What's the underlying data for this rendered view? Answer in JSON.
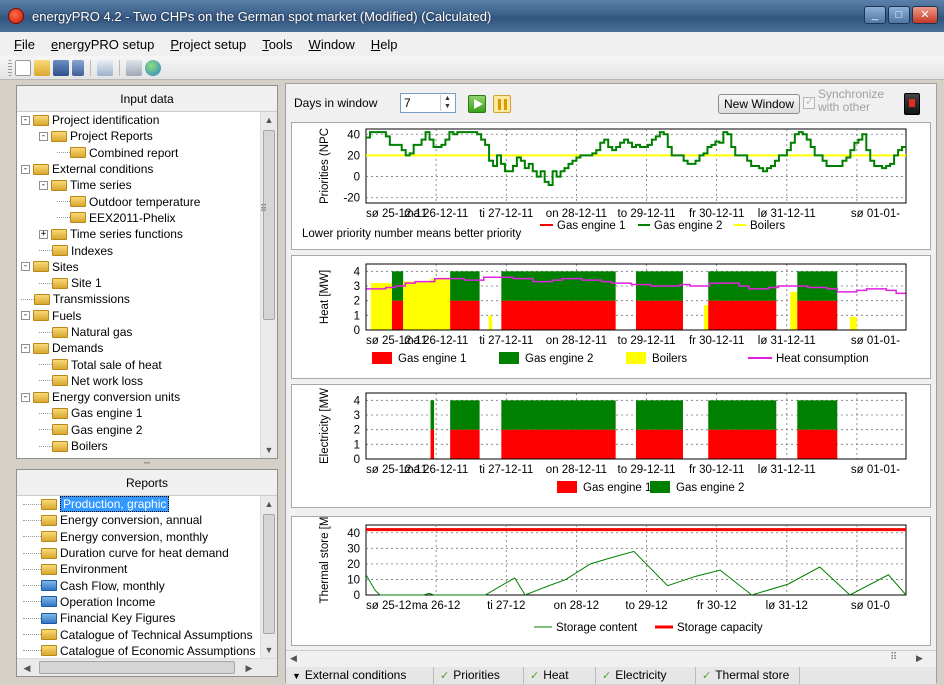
{
  "window": {
    "title": "energyPRO 4.2  -  Two CHPs on the German spot market (Modified) (Calculated)"
  },
  "menu": [
    "File",
    "energyPRO setup",
    "Project setup",
    "Tools",
    "Window",
    "Help"
  ],
  "input_panel": {
    "title": "Input data",
    "items": [
      {
        "label": "Project identification",
        "level": 0,
        "exp": "-"
      },
      {
        "label": "Project Reports",
        "level": 1,
        "exp": "-"
      },
      {
        "label": "Combined report",
        "level": 2,
        "exp": ""
      },
      {
        "label": "External conditions",
        "level": 0,
        "exp": "-"
      },
      {
        "label": "Time series",
        "level": 1,
        "exp": "-"
      },
      {
        "label": "Outdoor temperature",
        "level": 2,
        "exp": ""
      },
      {
        "label": "EEX2011-Phelix",
        "level": 2,
        "exp": ""
      },
      {
        "label": "Time series functions",
        "level": 1,
        "exp": "+"
      },
      {
        "label": "Indexes",
        "level": 1,
        "exp": ""
      },
      {
        "label": "Sites",
        "level": 0,
        "exp": "-"
      },
      {
        "label": "Site 1",
        "level": 1,
        "exp": ""
      },
      {
        "label": "Transmissions",
        "level": 0,
        "exp": ""
      },
      {
        "label": "Fuels",
        "level": 0,
        "exp": "-"
      },
      {
        "label": "Natural gas",
        "level": 1,
        "exp": ""
      },
      {
        "label": "Demands",
        "level": 0,
        "exp": "-"
      },
      {
        "label": "Total sale of heat",
        "level": 1,
        "exp": ""
      },
      {
        "label": "Net work loss",
        "level": 1,
        "exp": ""
      },
      {
        "label": "Energy conversion units",
        "level": 0,
        "exp": "-"
      },
      {
        "label": "Gas engine 1",
        "level": 1,
        "exp": ""
      },
      {
        "label": "Gas engine 2",
        "level": 1,
        "exp": ""
      },
      {
        "label": "Boilers",
        "level": 1,
        "exp": ""
      }
    ]
  },
  "reports_panel": {
    "title": "Reports",
    "items": [
      {
        "label": "Production, graphic",
        "color": "yellow",
        "selected": true
      },
      {
        "label": "Energy conversion, annual",
        "color": "yellow"
      },
      {
        "label": "Energy conversion, monthly",
        "color": "yellow"
      },
      {
        "label": "Duration curve for heat demand",
        "color": "yellow"
      },
      {
        "label": "Environment",
        "color": "yellow"
      },
      {
        "label": "Cash Flow, monthly",
        "color": "blue"
      },
      {
        "label": "Operation Income",
        "color": "blue"
      },
      {
        "label": "Financial Key Figures",
        "color": "blue"
      },
      {
        "label": "Catalogue of Technical Assumptions",
        "color": "yellow"
      },
      {
        "label": "Catalogue of Economic Assumptions",
        "color": "yellow"
      }
    ]
  },
  "controls": {
    "days_label": "Days in window",
    "days_value": "7",
    "new_window": "New Window",
    "sync_label": "Synchronize with other"
  },
  "colors": {
    "engine1": "#ff0000",
    "engine2": "#008000",
    "boilers": "#ffff00",
    "heat_consumption": "#e020e0",
    "storage_content": "#008000",
    "storage_capacity": "#ff0000"
  },
  "chart_data": [
    {
      "type": "line",
      "ylabel": "Priorities (NPC",
      "ylim": [
        -25,
        45
      ],
      "yticks": [
        40,
        20,
        0,
        -20
      ],
      "xticks": [
        "sø 25-12-11",
        "ma 26-12-11",
        "ti 27-12-11",
        "on 28-12-11",
        "to 29-12-11",
        "fr 30-12-11",
        "lø 31-12-11",
        "sø 01-01-"
      ],
      "note": "Lower priority number means better priority",
      "legend": [
        "Gas engine 1",
        "Gas engine 2",
        "Boilers"
      ],
      "series": [
        {
          "name": "Gas engine 2",
          "values": [
            37,
            42,
            42,
            42,
            42,
            38,
            30,
            30,
            30,
            25,
            20,
            22,
            30,
            30,
            35,
            42,
            35,
            28,
            28,
            30,
            35,
            42,
            40,
            42,
            42,
            42,
            42,
            42,
            40,
            35,
            30,
            15,
            10,
            20,
            12,
            5,
            5,
            10,
            18,
            15,
            8,
            12,
            5,
            0,
            5,
            -5,
            -8,
            5,
            0,
            5,
            8,
            12,
            15,
            18,
            20,
            20,
            20,
            22,
            25,
            32,
            35,
            28,
            25,
            28,
            32,
            35,
            32,
            28,
            30,
            28,
            28,
            30,
            35,
            38,
            42,
            40,
            28,
            20,
            20,
            20,
            15,
            12,
            12,
            15,
            20,
            22,
            28,
            30,
            33,
            32,
            42,
            40,
            28,
            20,
            20,
            20,
            15,
            10,
            10,
            8,
            5,
            8,
            10,
            15,
            20,
            20,
            25,
            32,
            40,
            42,
            40,
            35,
            28,
            20,
            20,
            15,
            10,
            10,
            10,
            10,
            15,
            18,
            25,
            32,
            35,
            40,
            25,
            15,
            10,
            10,
            8,
            10,
            12,
            20,
            25,
            28
          ]
        },
        {
          "name": "Boilers",
          "values": [
            20,
            20
          ]
        }
      ]
    },
    {
      "type": "bar",
      "ylabel": "Heat [MW]",
      "ylim": [
        0,
        4.5
      ],
      "yticks": [
        4,
        3,
        2,
        1,
        0
      ],
      "xticks": [
        "sø 25-12-11",
        "ma 26-12-11",
        "ti 27-12-11",
        "on 28-12-11",
        "to 29-12-11",
        "fr 30-12-11",
        "lø 31-12-11",
        "sø 01-01-"
      ],
      "legend": [
        "Gas engine 1",
        "Gas engine 2",
        "Boilers",
        "Heat consumption"
      ],
      "blocks": [
        {
          "x0": 0.07,
          "x1": 0.37,
          "engine1": 0,
          "engine2": 0,
          "boilers": 3.2
        },
        {
          "x0": 0.37,
          "x1": 0.53,
          "engine1": 2.0,
          "engine2": 2.0,
          "boilers": 0
        },
        {
          "x0": 0.53,
          "x1": 0.92,
          "engine1": 0,
          "engine2": 0,
          "boilers": 3.3
        },
        {
          "x0": 0.92,
          "x1": 1.2,
          "engine1": 0,
          "engine2": 0,
          "boilers": 3.5
        },
        {
          "x0": 1.2,
          "x1": 1.62,
          "engine1": 2.0,
          "engine2": 2.0,
          "boilers": 0
        },
        {
          "x0": 1.75,
          "x1": 1.8,
          "engine1": 0,
          "engine2": 0,
          "boilers": 1.0
        },
        {
          "x0": 1.8,
          "x1": 1.93,
          "engine1": 0,
          "engine2": 0,
          "boilers": 0
        },
        {
          "x0": 1.93,
          "x1": 3.56,
          "engine1": 2.0,
          "engine2": 2.0,
          "boilers": 0
        },
        {
          "x0": 3.85,
          "x1": 4.52,
          "engine1": 2.0,
          "engine2": 2.0,
          "boilers": 0
        },
        {
          "x0": 4.82,
          "x1": 4.88,
          "engine1": 0,
          "engine2": 0,
          "boilers": 1.7
        },
        {
          "x0": 4.88,
          "x1": 5.85,
          "engine1": 2.0,
          "engine2": 2.0,
          "boilers": 0
        },
        {
          "x0": 6.05,
          "x1": 6.15,
          "engine1": 0,
          "engine2": 0,
          "boilers": 2.6
        },
        {
          "x0": 6.15,
          "x1": 6.72,
          "engine1": 2.0,
          "engine2": 2.0,
          "boilers": 0
        },
        {
          "x0": 6.9,
          "x1": 7.0,
          "engine1": 0,
          "engine2": 0,
          "boilers": 0.9
        }
      ],
      "heat_consumption": [
        2.8,
        2.8,
        2.9,
        3.0,
        3.2,
        3.3,
        3.3,
        3.5,
        3.5,
        3.5,
        3.4,
        3.4,
        3.6,
        3.6,
        3.6,
        3.5,
        3.5,
        3.3,
        3.3,
        3.4,
        3.5,
        3.5,
        3.4,
        3.4,
        3.3,
        3.2,
        3.2,
        3.1,
        3.1,
        3.0,
        3.0,
        3.0,
        3.1,
        3.0,
        3.0,
        3.2,
        3.2,
        3.2,
        3.0,
        2.8,
        2.8,
        2.9,
        3.0,
        3.0,
        3.0,
        2.9,
        2.9,
        2.8,
        2.6,
        2.6,
        2.7,
        2.8,
        2.8,
        2.7,
        2.5
      ]
    },
    {
      "type": "bar",
      "ylabel": "Electricity [MW",
      "ylim": [
        0,
        4.5
      ],
      "yticks": [
        4,
        3,
        2,
        1,
        0
      ],
      "xticks": [
        "sø 25-12-11",
        "ma 26-12-11",
        "ti 27-12-11",
        "on 28-12-11",
        "to 29-12-11",
        "fr 30-12-11",
        "lø 31-12-11",
        "sø 01-01-"
      ],
      "legend": [
        "Gas engine 1",
        "Gas engine 2"
      ],
      "blocks": [
        {
          "x0": 0.92,
          "x1": 0.97,
          "engine1": 2.0,
          "engine2": 2.0
        },
        {
          "x0": 1.2,
          "x1": 1.62,
          "engine1": 2.0,
          "engine2": 2.0
        },
        {
          "x0": 1.93,
          "x1": 3.56,
          "engine1": 2.0,
          "engine2": 2.0
        },
        {
          "x0": 3.85,
          "x1": 4.52,
          "engine1": 2.0,
          "engine2": 2.0
        },
        {
          "x0": 4.88,
          "x1": 5.85,
          "engine1": 2.0,
          "engine2": 2.0
        },
        {
          "x0": 6.15,
          "x1": 6.72,
          "engine1": 2.0,
          "engine2": 2.0
        }
      ]
    },
    {
      "type": "line",
      "ylabel": "Thermal store [M",
      "ylim": [
        0,
        45
      ],
      "yticks": [
        40,
        30,
        20,
        10,
        0
      ],
      "xticks": [
        "sø 25-12",
        "ma 26-12",
        "ti 27-12",
        "on 28-12",
        "to 29-12",
        "fr 30-12",
        "lø 31-12",
        "sø 01-0"
      ],
      "legend": [
        "Storage content",
        "Storage capacity"
      ],
      "series": [
        {
          "name": "Storage content",
          "points": [
            [
              0,
              13
            ],
            [
              0.13,
              3
            ],
            [
              0.2,
              0
            ],
            [
              0.82,
              0
            ],
            [
              0.9,
              1
            ],
            [
              0.97,
              0
            ],
            [
              1.7,
              0
            ],
            [
              2.12,
              11
            ],
            [
              2.27,
              0
            ],
            [
              2.55,
              5
            ],
            [
              2.85,
              10
            ],
            [
              3.2,
              20
            ],
            [
              3.5,
              24
            ],
            [
              3.82,
              28
            ],
            [
              4.3,
              6
            ],
            [
              4.7,
              12
            ],
            [
              5.05,
              16
            ],
            [
              5.5,
              0
            ],
            [
              6.02,
              7
            ],
            [
              6.47,
              18
            ],
            [
              6.9,
              0
            ],
            [
              7.45,
              13
            ],
            [
              7.7,
              0
            ]
          ]
        },
        {
          "name": "Storage capacity",
          "points": [
            [
              0,
              42
            ],
            [
              7.7,
              42
            ]
          ]
        }
      ]
    }
  ],
  "tabs": [
    {
      "label": "External conditions",
      "kind": "dropdown"
    },
    {
      "label": "Priorities",
      "kind": "check"
    },
    {
      "label": "Heat",
      "kind": "check"
    },
    {
      "label": "Electricity",
      "kind": "check"
    },
    {
      "label": "Thermal store",
      "kind": "check"
    }
  ]
}
